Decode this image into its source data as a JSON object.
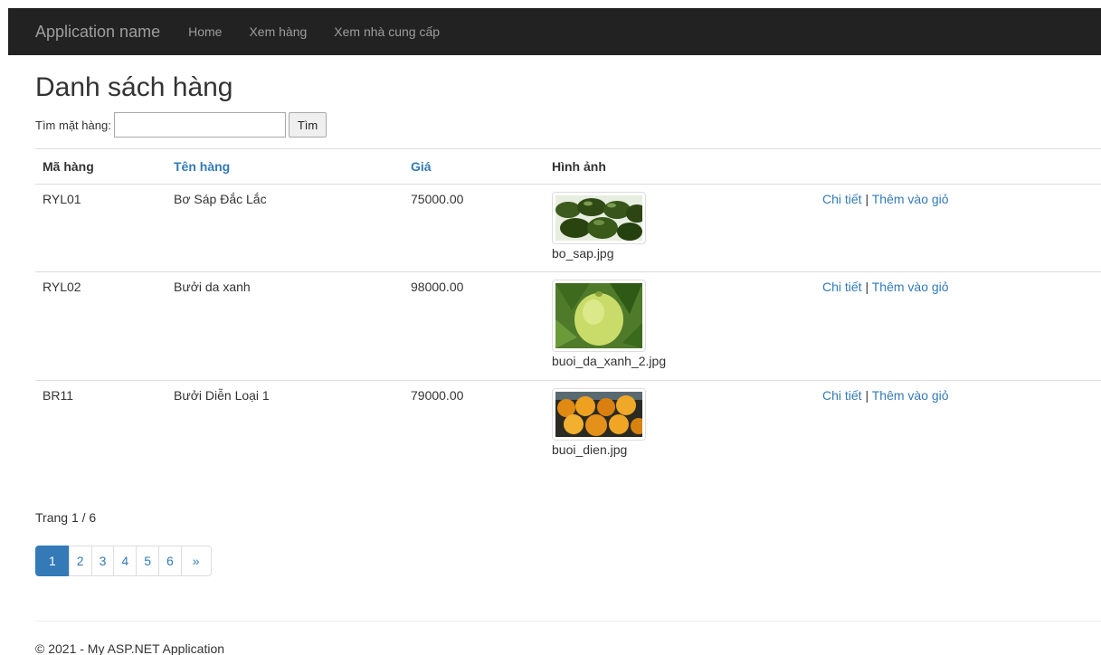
{
  "nav": {
    "brand": "Application name",
    "links": [
      "Home",
      "Xem hàng",
      "Xem nhà cung cấp"
    ]
  },
  "page_title": "Danh sách hàng",
  "search": {
    "label": "Tìm mặt hàng:",
    "value": "",
    "button": "Tìm"
  },
  "table": {
    "headers": [
      "Mã hàng",
      "Tên hàng",
      "Giá",
      "Hình ảnh"
    ],
    "rows": [
      {
        "code": "RYL01",
        "name": "Bơ Sáp Đắc Lắc",
        "price": "75000.00",
        "image": "bo_sap.jpg",
        "detail": "Chi tiết",
        "sep": "|",
        "add": "Thêm vào giỏ"
      },
      {
        "code": "RYL02",
        "name": "Bưởi da xanh",
        "price": "98000.00",
        "image": "buoi_da_xanh_2.jpg",
        "detail": "Chi tiết",
        "sep": "|",
        "add": "Thêm vào giỏ"
      },
      {
        "code": "BR11",
        "name": "Bưởi Diễn Loại 1",
        "price": "79000.00",
        "image": "buoi_dien.jpg",
        "detail": "Chi tiết",
        "sep": "|",
        "add": "Thêm vào giỏ"
      }
    ]
  },
  "paging": {
    "info": "Trang 1 / 6",
    "pages": [
      "1",
      "2",
      "3",
      "4",
      "5",
      "6"
    ],
    "next": "»",
    "current": "1"
  },
  "footer": "© 2021 - My ASP.NET Application",
  "colors": {
    "navbar": "#222222",
    "link": "#337ab7",
    "active_page": "#337ab7"
  }
}
